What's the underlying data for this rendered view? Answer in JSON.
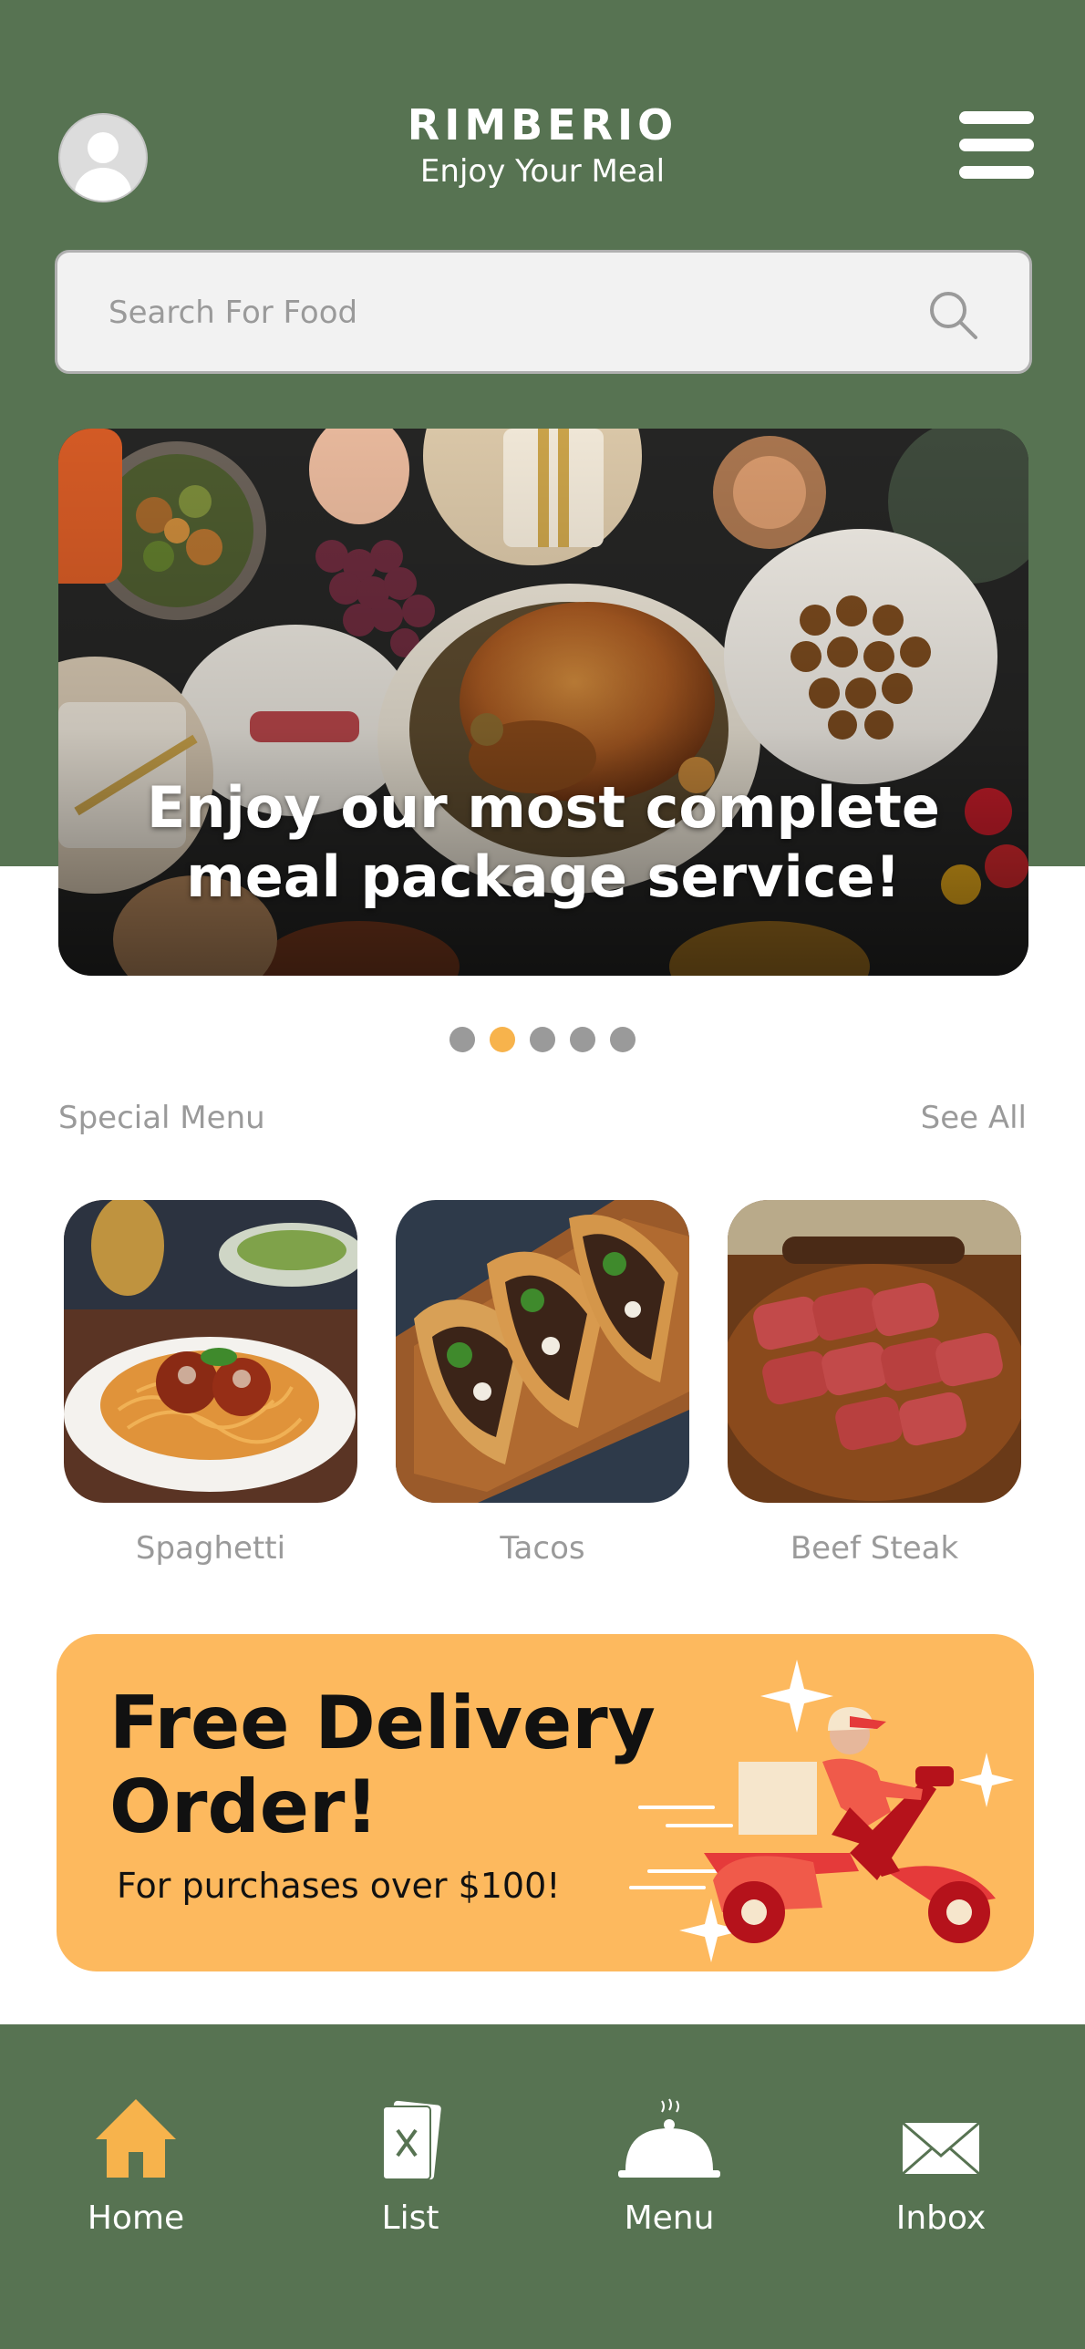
{
  "app": {
    "brand_name": "RIMBERIO",
    "tagline": "Enjoy Your Meal",
    "icons": {
      "avatar": "user-avatar-icon",
      "menu": "hamburger-menu-icon",
      "search": "search-icon"
    }
  },
  "search": {
    "placeholder": "Search For Food",
    "value": ""
  },
  "banner": {
    "line1": "Enjoy our most complete",
    "line2": "meal package service!",
    "dots_count": 5,
    "active_dot": 2
  },
  "special_menu": {
    "title": "Special Menu",
    "see_all": "See All",
    "items": [
      {
        "label": "Spaghetti"
      },
      {
        "label": "Tacos"
      },
      {
        "label": "Beef Steak"
      }
    ]
  },
  "promo": {
    "title_line1": "Free Delivery",
    "title_line2": "Order!",
    "subtitle": "For purchases over $100!"
  },
  "bottom_nav": {
    "items": [
      {
        "label": "Home",
        "icon": "home-icon"
      },
      {
        "label": "List",
        "icon": "list-menu-card-icon"
      },
      {
        "label": "Menu",
        "icon": "food-cloche-icon"
      },
      {
        "label": "Inbox",
        "icon": "envelope-icon"
      }
    ]
  },
  "colors": {
    "primary_green": "#577352",
    "accent_orange": "#f7b34c",
    "promo_bg": "#fdb95e",
    "delivery_red": "#e53a3a",
    "muted_text": "#9a9a9a"
  }
}
